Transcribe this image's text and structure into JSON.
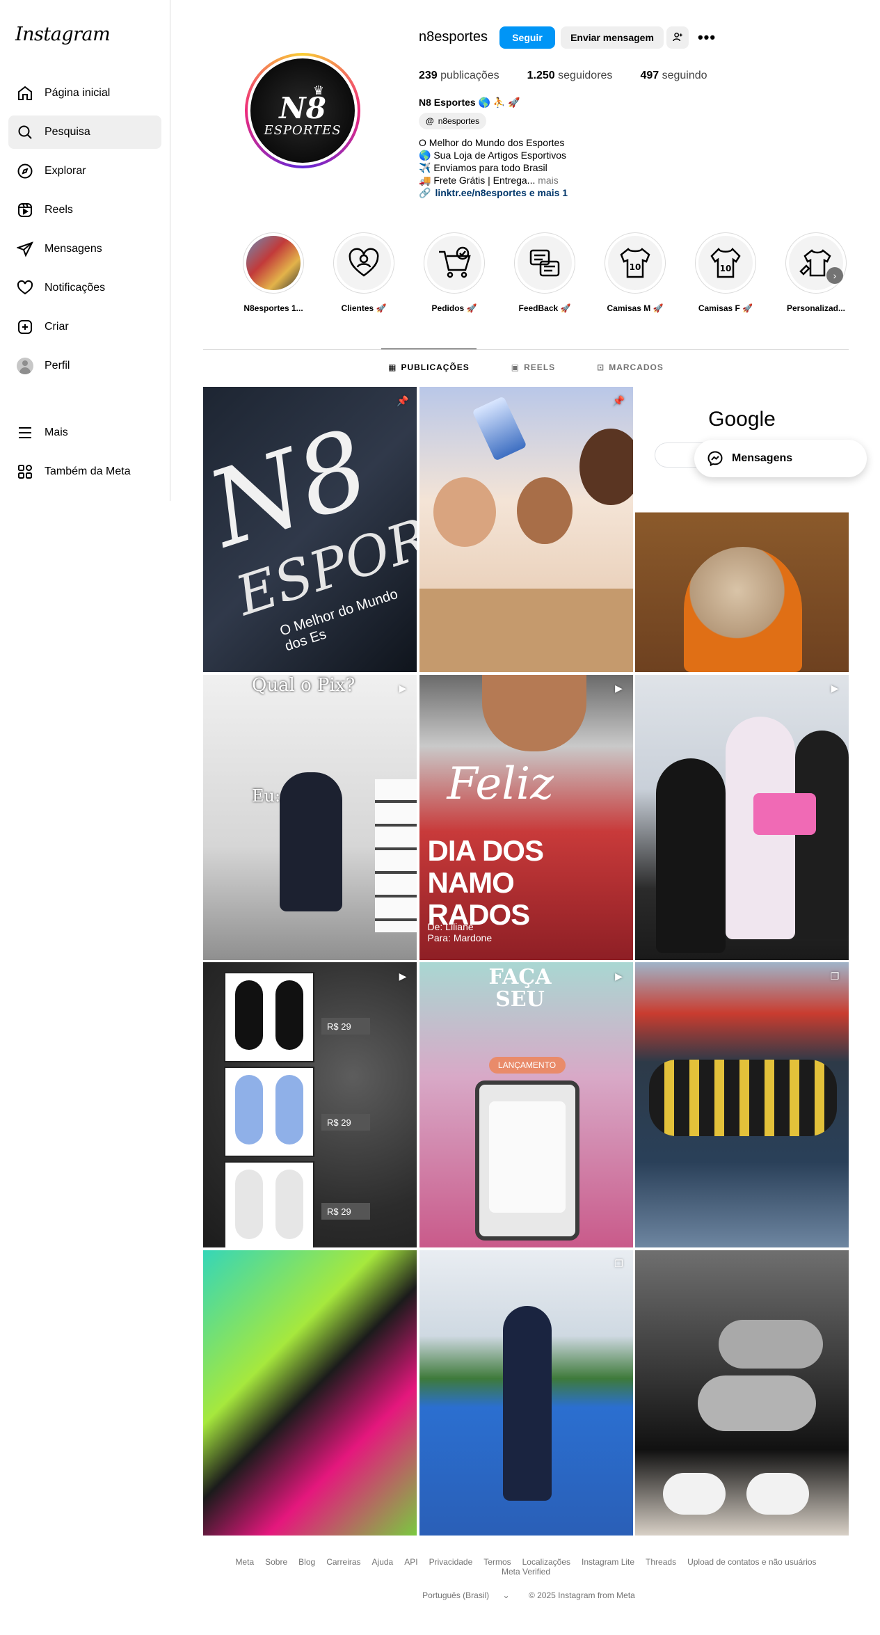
{
  "app": {
    "logo": "Instagram"
  },
  "sidebar": {
    "items": [
      {
        "label": "Página inicial",
        "icon": "home-icon"
      },
      {
        "label": "Pesquisa",
        "icon": "search-icon",
        "active": true
      },
      {
        "label": "Explorar",
        "icon": "compass-icon"
      },
      {
        "label": "Reels",
        "icon": "reels-icon"
      },
      {
        "label": "Mensagens",
        "icon": "messenger-icon"
      },
      {
        "label": "Notificações",
        "icon": "heart-icon"
      },
      {
        "label": "Criar",
        "icon": "plus-square-icon"
      },
      {
        "label": "Perfil",
        "icon": "avatar"
      }
    ],
    "more": {
      "label": "Mais",
      "icon": "menu-icon"
    },
    "meta": {
      "label": "Também da Meta",
      "icon": "apps-icon"
    }
  },
  "profile": {
    "username": "n8esportes",
    "follow_label": "Seguir",
    "message_label": "Enviar mensagem",
    "stats": {
      "posts_count": "239",
      "posts_label": "publicações",
      "followers_count": "1.250",
      "followers_label": "seguidores",
      "following_count": "497",
      "following_label": "seguindo"
    },
    "bio": {
      "name": "N8 Esportes 🌎 ⛹️ 🚀",
      "threads_handle": "n8esportes",
      "lines": [
        "O Melhor do Mundo dos Esportes",
        "🌎 Sua Loja de Artigos Esportivos",
        "✈️ Enviamos para todo Brasil",
        "🚚 Frete Grátis | Entrega..."
      ],
      "more_label": "mais",
      "link": "linktr.ee/n8esportes e mais 1"
    },
    "picture": {
      "crown": "♛",
      "text_main": "N8",
      "text_sub": "ESPORTES"
    }
  },
  "highlights": [
    {
      "label": "N8esportes 1..."
    },
    {
      "label": "Clientes 🚀"
    },
    {
      "label": "Pedidos 🚀"
    },
    {
      "label": "FeedBack 🚀"
    },
    {
      "label": "Camisas M 🚀"
    },
    {
      "label": "Camisas F 🚀"
    },
    {
      "label": "Personalizad..."
    }
  ],
  "tabs": [
    {
      "label": "PUBLICAÇÕES",
      "icon": "grid-icon",
      "active": true
    },
    {
      "label": "REELS",
      "icon": "reels-icon"
    },
    {
      "label": "MARCADOS",
      "icon": "tagged-icon"
    }
  ],
  "posts": {
    "p1": {
      "line1": "N8",
      "line2": "ESPORTES",
      "tagline": "O Melhor do Mundo dos Es"
    },
    "p3": {
      "brand": "Google"
    },
    "p4": {
      "title": "Qual o Pix?",
      "caption": "Eu:"
    },
    "p5": {
      "feliz": "Feliz",
      "dia_line1": "DIA DOS",
      "dia_line2": "NAMO",
      "dia_line3": "RADOS",
      "from": "De: Liliane",
      "to": "Para: Mardone"
    },
    "p7": {
      "price1": "R$ 29",
      "price2": "R$ 29",
      "price3": "R$ 29"
    },
    "p8": {
      "faca_line1": "FAÇA",
      "faca_line2": "SEU",
      "launch": "LANÇAMENTO"
    }
  },
  "floating": {
    "label": "Mensagens"
  },
  "footer": {
    "links": [
      "Meta",
      "Sobre",
      "Blog",
      "Carreiras",
      "Ajuda",
      "API",
      "Privacidade",
      "Termos",
      "Localizações",
      "Instagram Lite",
      "Threads",
      "Upload de contatos e não usuários",
      "Meta Verified"
    ],
    "language": "Português (Brasil)",
    "copyright": "© 2025 Instagram from Meta"
  }
}
